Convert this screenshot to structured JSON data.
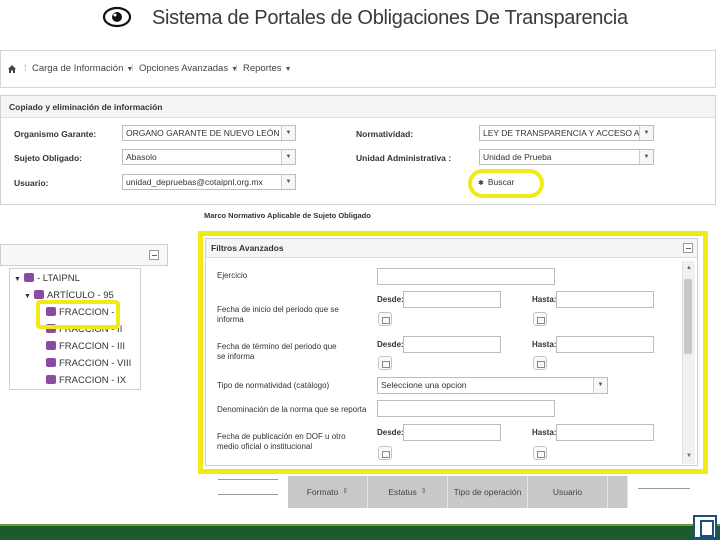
{
  "header": {
    "title": "Sistema de Portales de Obligaciones De Transparencia"
  },
  "nav": {
    "home_icon": "home-icon",
    "items": [
      {
        "label": "Carga de Información"
      },
      {
        "label": "Opciones Avanzadas"
      },
      {
        "label": "Reportes"
      }
    ]
  },
  "copy_panel": {
    "title": "Copiado y eliminación de información",
    "fields": {
      "organismo": {
        "label": "Organismo Garante:",
        "value": "ORGANO GARANTE DE NUEVO LEÓN"
      },
      "normatividad": {
        "label": "Normatividad:",
        "value": "LEY DE TRANSPARENCIA Y ACCESO A LA I"
      },
      "sujeto": {
        "label": "Sujeto Obligado:",
        "value": "Abasolo"
      },
      "unidad": {
        "label": "Unidad Administrativa :",
        "value": "Unidad de Prueba"
      },
      "usuario": {
        "label": "Usuario:",
        "value": "unidad_depruebas@cotaipnl.org.mx"
      }
    },
    "search_button": "Buscar"
  },
  "marco_label": "Marco Normativo Aplicable de Sujeto Obligado",
  "tree": {
    "root": "- LTAIPNL",
    "child": "ARTÍCULO - 95",
    "leaves": [
      "FRACCION - I",
      "FRACCION - II",
      "FRACCION - III",
      "FRACCION - VIII",
      "FRACCION - IX"
    ]
  },
  "filtros": {
    "title": "Filtros Avanzados",
    "ejercicio": "Ejercicio",
    "periodo_inicio": "Fecha de inicio del periodo que se informa",
    "periodo_termino": "Fecha de término del periodo que se informa",
    "tipo_norm": "Tipo de normatividad (catálogo)",
    "tipo_norm_value": "Seleccione una opcion",
    "denominacion": "Denominación de la norma que se reporta",
    "publicacion": "Fecha de publicación en DOF u otro medio oficial o institucional",
    "desde": "Desde:",
    "hasta": "Hasta:"
  },
  "table": {
    "headers": [
      "Formato",
      "Estatus",
      "Tipo de operación",
      "Usuario"
    ]
  },
  "colors": {
    "highlight": "#f2ea17",
    "footer": "#1c5b2e",
    "tree_icon": "#8a4aa6"
  }
}
